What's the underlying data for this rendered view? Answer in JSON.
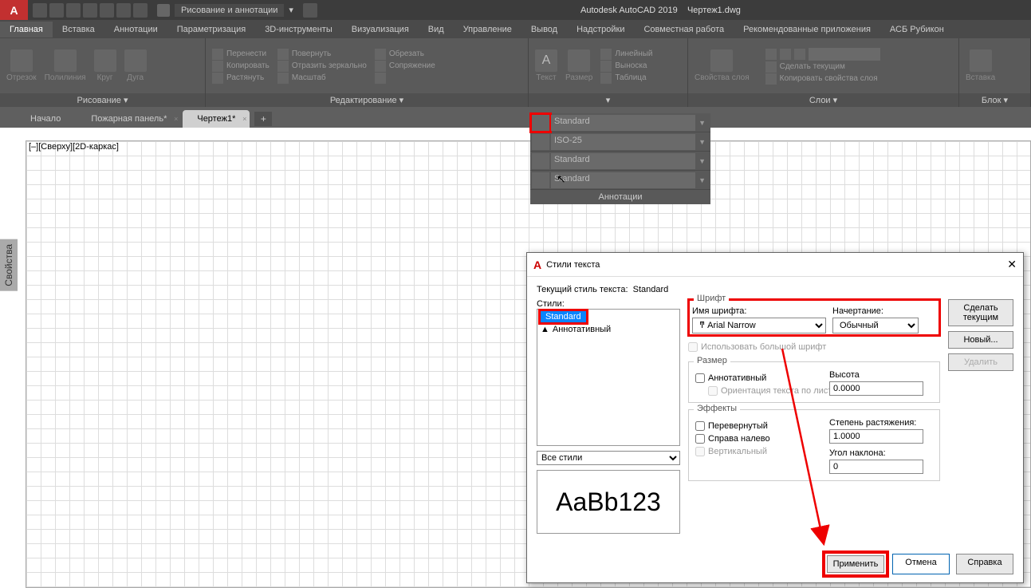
{
  "title": {
    "app": "Autodesk AutoCAD 2019",
    "file": "Чертеж1.dwg",
    "qatLabel": "Рисование и аннотации"
  },
  "menu": {
    "items": [
      "Главная",
      "Вставка",
      "Аннотации",
      "Параметризация",
      "3D-инструменты",
      "Визуализация",
      "Вид",
      "Управление",
      "Вывод",
      "Надстройки",
      "Совместная работа",
      "Рекомендованные приложения",
      "АСБ Рубикон"
    ]
  },
  "ribbon": {
    "draw": {
      "title": "Рисование",
      "tools": [
        "Отрезок",
        "Полилиния",
        "Круг",
        "Дуга"
      ]
    },
    "edit": {
      "title": "Редактирование",
      "rows1": [
        "Перенести",
        "Копировать",
        "Растянуть"
      ],
      "rows2": [
        "Повернуть",
        "Отразить зеркально",
        "Масштаб"
      ],
      "rows3": [
        "Обрезать",
        "Сопряжение",
        ""
      ]
    },
    "text": {
      "t1": "Текст",
      "t2": "Размер",
      "r": [
        "Линейный",
        "Выноска",
        "Таблица"
      ]
    },
    "layers": {
      "title": "Слои",
      "prop": "Свойства слоя",
      "a": "Сделать текущим",
      "b": "Копировать свойства слоя"
    },
    "block": {
      "title": "Блок",
      "t": "Вставка"
    }
  },
  "doctabs": {
    "t0": "Начало",
    "t1": "Пожарная панель*",
    "t2": "Чертеж1*"
  },
  "viewlabel": "[–][Сверху][2D-каркас]",
  "sidebar": "Свойства",
  "flyout": {
    "r0": "Standard",
    "r1": "ISO-25",
    "r2": "Standard",
    "r3": "Standard",
    "title": "Аннотации"
  },
  "dialog": {
    "title": "Стили текста",
    "curLabel": "Текущий стиль текста:",
    "curVal": "Standard",
    "stylesLabel": "Стили:",
    "style0": "Standard",
    "style1": "Аннотативный",
    "filter": "Все стили",
    "preview": "AaBb123",
    "font": {
      "group": "Шрифт",
      "nameLabel": "Имя шрифта:",
      "nameVal": "Arial Narrow",
      "styleLabel": "Начертание:",
      "styleVal": "Обычный",
      "bigFont": "Использовать большой шрифт"
    },
    "size": {
      "group": "Размер",
      "anno": "Аннотативный",
      "orient": "Ориентация текста по листу",
      "hLabel": "Высота",
      "hVal": "0.0000"
    },
    "fx": {
      "group": "Эффекты",
      "flip": "Перевернутый",
      "rtl": "Справа налево",
      "vert": "Вертикальный",
      "stretchLabel": "Степень растяжения:",
      "stretchVal": "1.0000",
      "angLabel": "Угол наклона:",
      "angVal": "0"
    },
    "btns": {
      "setcur": "Сделать текущим",
      "new": "Новый...",
      "del": "Удалить",
      "apply": "Применить",
      "cancel": "Отмена",
      "help": "Справка"
    }
  }
}
